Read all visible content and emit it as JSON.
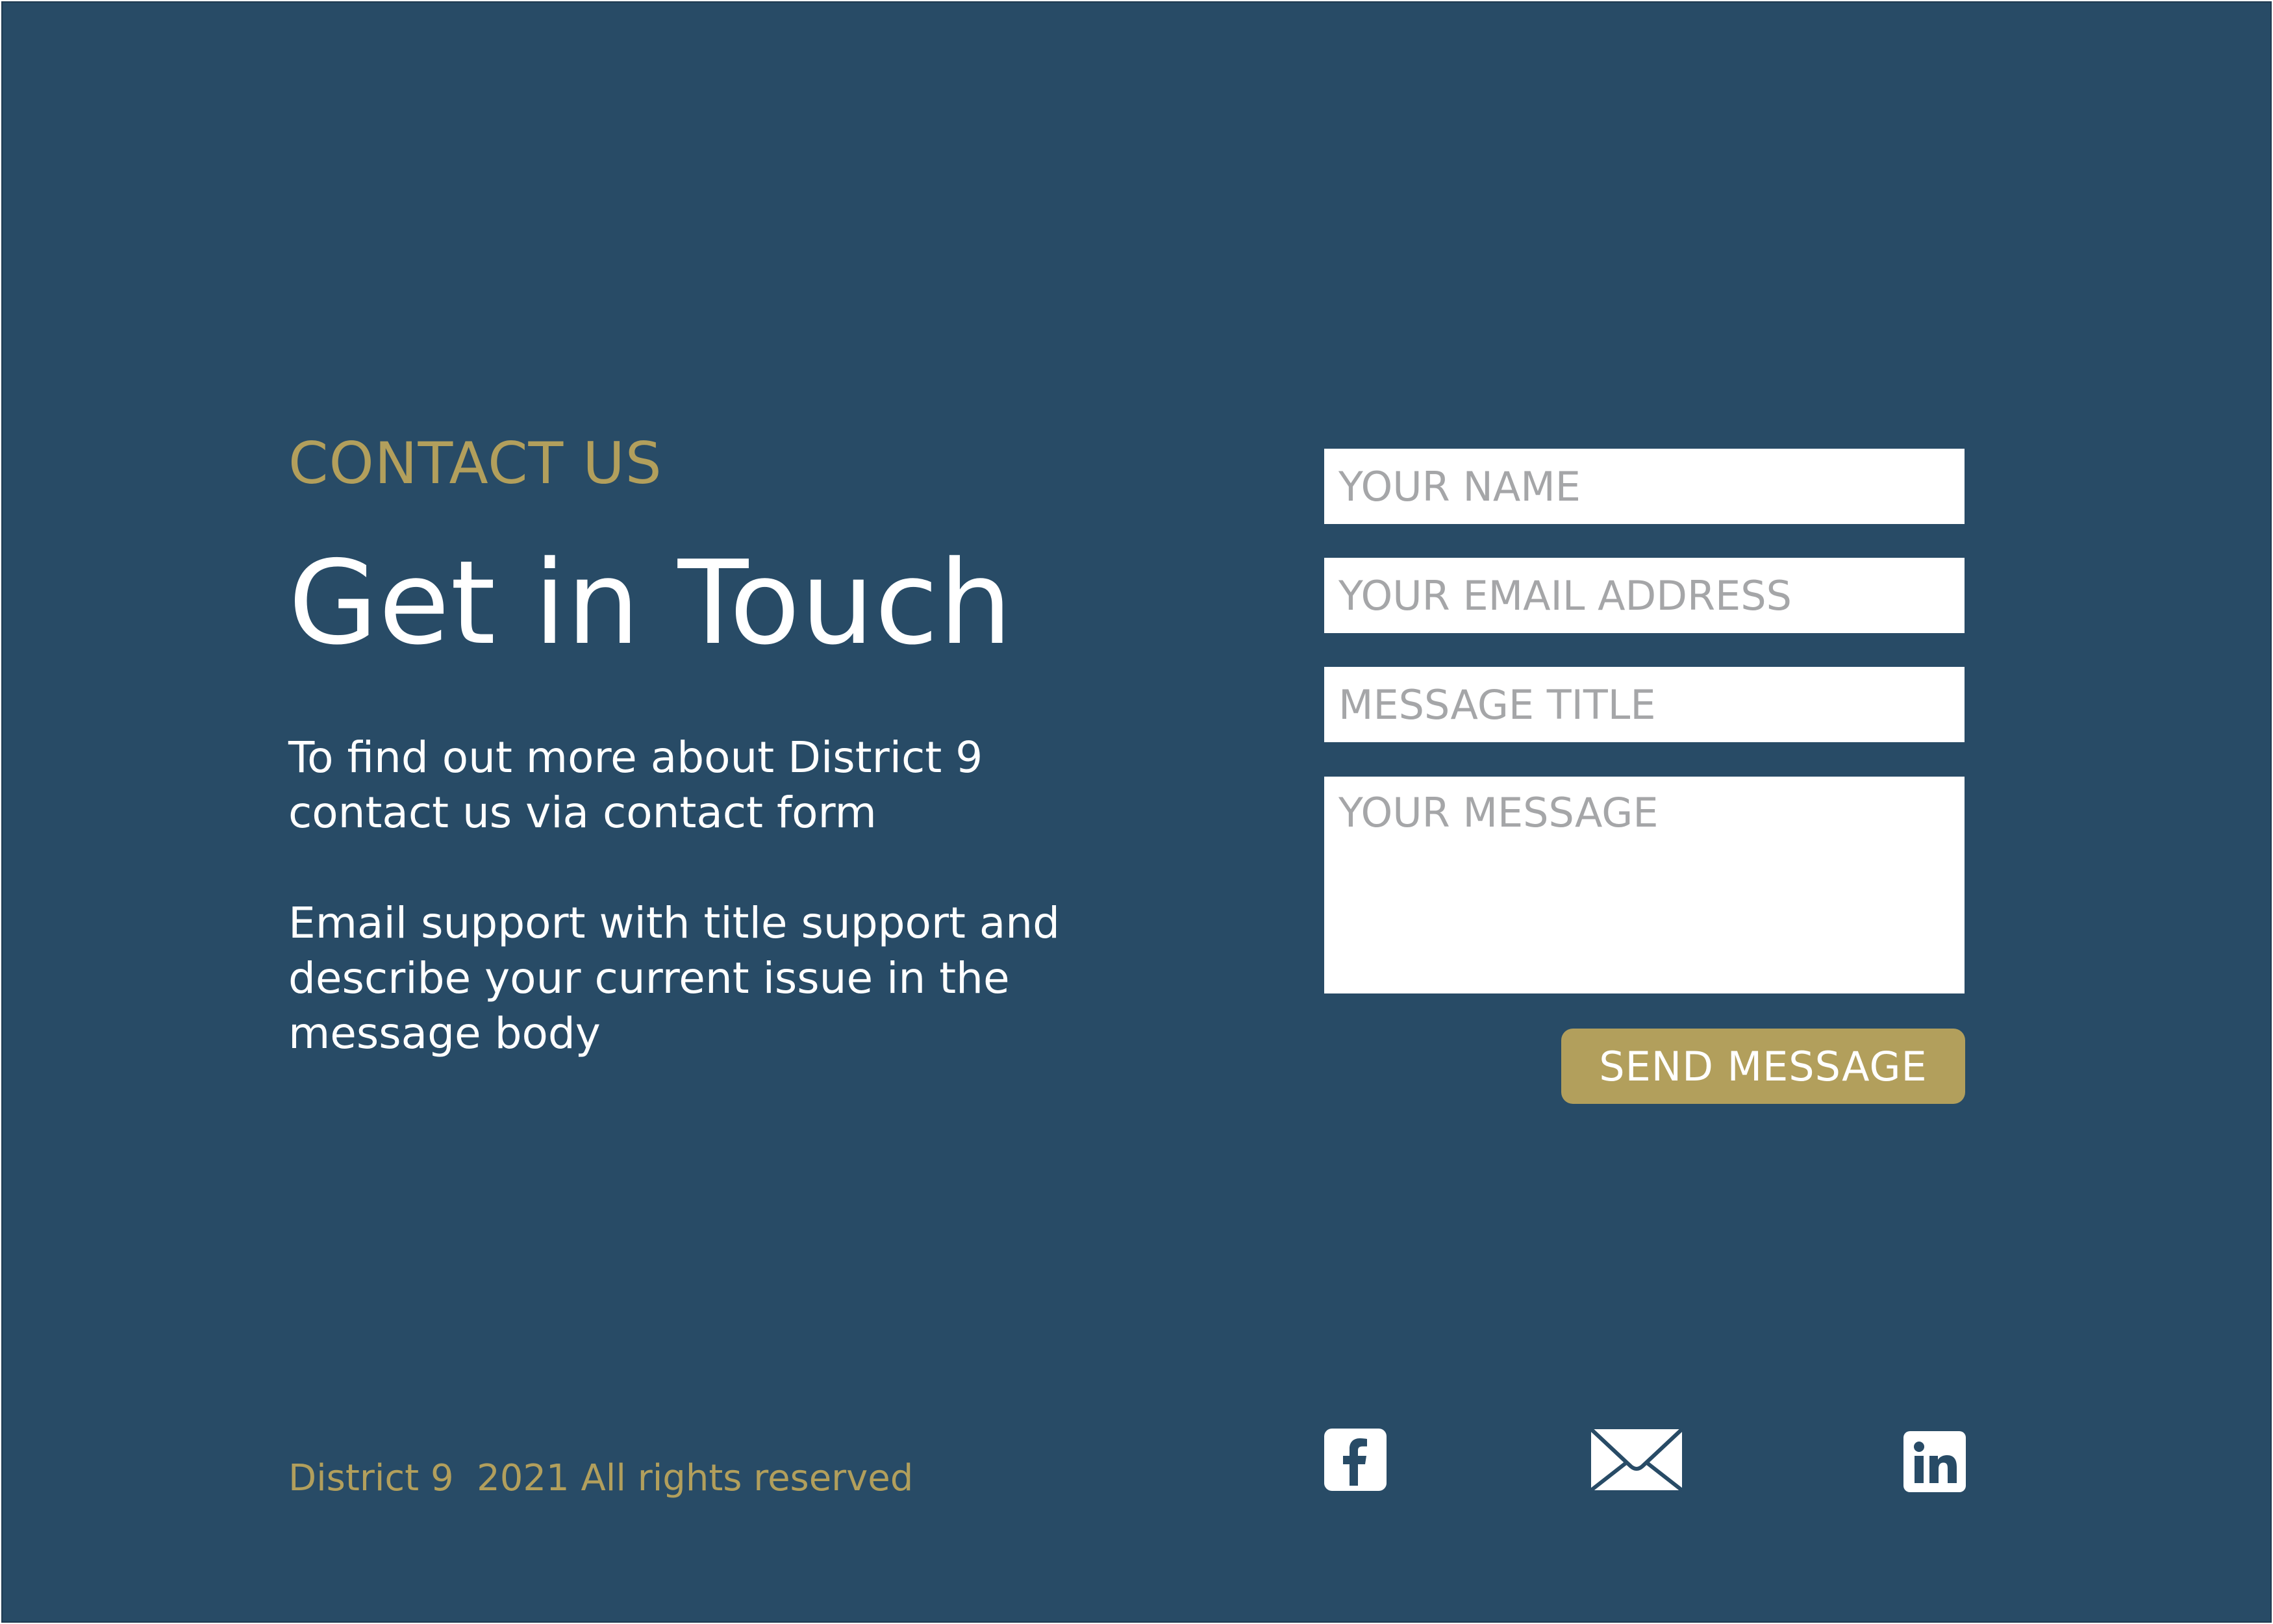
{
  "contact": {
    "eyebrow": "CONTACT US",
    "headline": "Get in Touch",
    "paragraph1": "To find out more about District 9 contact us via contact form",
    "paragraph2": "Email support with title support and describe your current issue in the message body"
  },
  "form": {
    "name_placeholder": "YOUR NAME",
    "email_placeholder": "YOUR EMAIL ADDRESS",
    "title_placeholder": "MESSAGE TITLE",
    "message_placeholder": "YOUR MESSAGE",
    "send_label": "SEND MESSAGE"
  },
  "social": [
    {
      "icon": "facebook-icon"
    },
    {
      "icon": "mail-icon"
    },
    {
      "icon": "linkedin-icon"
    }
  ],
  "footer": {
    "copyright": "District 9  2021 All rights reserved"
  },
  "colors": {
    "background": "#284b66",
    "accent": "#b29f5c",
    "text": "#ffffff",
    "placeholder": "#a5a6a8"
  }
}
